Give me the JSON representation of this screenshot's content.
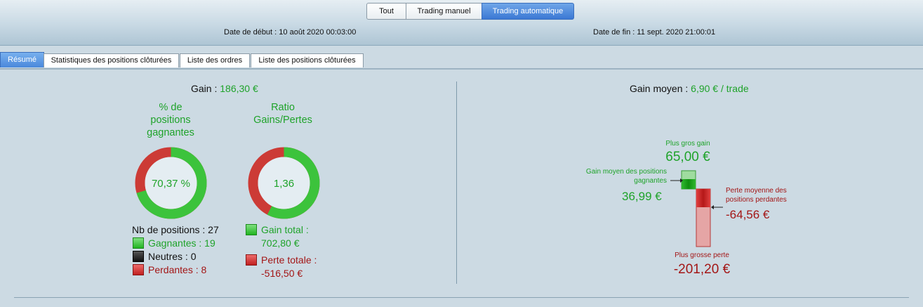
{
  "filters": {
    "tout": "Tout",
    "manuel": "Trading manuel",
    "auto": "Trading automatique"
  },
  "dates": {
    "debut_label": "Date de début :",
    "debut_value": "10 août 2020 00:03:00",
    "fin_label": "Date de fin :",
    "fin_value": "11 sept. 2020 21:00:01"
  },
  "tabs": [
    "Résumé",
    "Statistiques des positions clôturées",
    "Liste des ordres",
    "Liste des positions clôturées"
  ],
  "left": {
    "gain_label": "Gain :",
    "gain_value": "186,30 €",
    "pct_title_1": "% de",
    "pct_title_2": "positions",
    "pct_title_3": "gagnantes",
    "ratio_title_1": "Ratio",
    "ratio_title_2": "Gains/Pertes",
    "pct_value": "70,37 %",
    "pct_fraction": 0.7037,
    "ratio_value": "1,36",
    "ratio_fraction": 0.5764,
    "nb_positions": "Nb de positions : 27",
    "gagnantes": "Gagnantes : 19",
    "neutres": "Neutres : 0",
    "perdantes": "Perdantes : 8",
    "gain_total_label": "Gain total :",
    "gain_total_value": "702,80 €",
    "perte_totale_label": "Perte totale :",
    "perte_totale_value": "-516,50 €"
  },
  "right": {
    "gain_moyen_label": "Gain moyen :",
    "gain_moyen_value": "6,90 € / trade",
    "plus_gros_gain_label": "Plus gros gain",
    "plus_gros_gain_value": "65,00 €",
    "gain_moyen_pos_label_1": "Gain moyen des positions",
    "gain_moyen_pos_label_2": "gagnantes",
    "gain_moyen_pos_value": "36,99 €",
    "perte_moy_label_1": "Perte moyenne des",
    "perte_moy_label_2": "positions perdantes",
    "perte_moy_value": "-64,56 €",
    "plus_grosse_perte_label": "Plus grosse perte",
    "plus_grosse_perte_value": "-201,20 €"
  },
  "colors": {
    "accent_green": "#1fa32a",
    "accent_red": "#a31616",
    "active_blue": "#4a88db"
  }
}
